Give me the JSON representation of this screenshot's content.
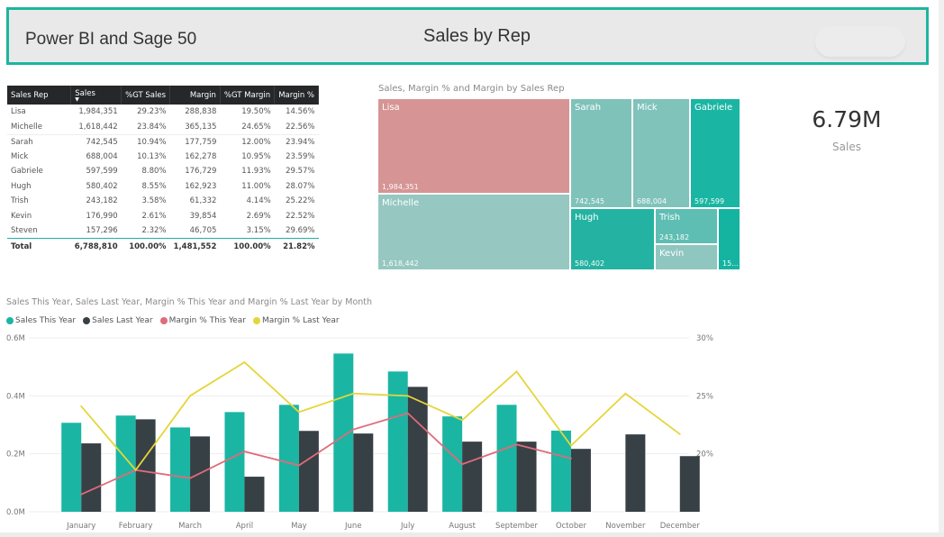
{
  "header": {
    "brand": "Power BI and Sage 50",
    "title": "Sales by Rep",
    "accent": "#1db5a0"
  },
  "table": {
    "columns": [
      "Sales Rep",
      "Sales",
      "%GT Sales",
      "Margin",
      "%GT Margin",
      "Margin %"
    ],
    "sorted_column": "Sales",
    "rows": [
      [
        "Lisa",
        "1,984,351",
        "29.23%",
        "288,838",
        "19.50%",
        "14.56%"
      ],
      [
        "Michelle",
        "1,618,442",
        "23.84%",
        "365,135",
        "24.65%",
        "22.56%"
      ],
      [
        "Sarah",
        "742,545",
        "10.94%",
        "177,759",
        "12.00%",
        "23.94%"
      ],
      [
        "Mick",
        "688,004",
        "10.13%",
        "162,278",
        "10.95%",
        "23.59%"
      ],
      [
        "Gabriele",
        "597,599",
        "8.80%",
        "176,729",
        "11.93%",
        "29.57%"
      ],
      [
        "Hugh",
        "580,402",
        "8.55%",
        "162,923",
        "11.00%",
        "28.07%"
      ],
      [
        "Trish",
        "243,182",
        "3.58%",
        "61,332",
        "4.14%",
        "25.22%"
      ],
      [
        "Kevin",
        "176,990",
        "2.61%",
        "39,854",
        "2.69%",
        "22.52%"
      ],
      [
        "Steven",
        "157,296",
        "2.32%",
        "46,705",
        "3.15%",
        "29.69%"
      ]
    ],
    "total": [
      "Total",
      "6,788,810",
      "100.00%",
      "1,481,552",
      "100.00%",
      "21.82%"
    ]
  },
  "treemap": {
    "title": "Sales, Margin % and Margin by Sales Rep",
    "tiles": [
      {
        "name": "Lisa",
        "value": "1,984,351",
        "color": "#d69594"
      },
      {
        "name": "Michelle",
        "value": "1,618,442",
        "color": "#96c8c1"
      },
      {
        "name": "Sarah",
        "value": "742,545",
        "color": "#7fc2ba"
      },
      {
        "name": "Mick",
        "value": "688,004",
        "color": "#80c3bb"
      },
      {
        "name": "Gabriele",
        "value": "597,599",
        "color": "#1ab6a3"
      },
      {
        "name": "Hugh",
        "value": "580,402",
        "color": "#24b3a2"
      },
      {
        "name": "Trish",
        "value": "243,182",
        "color": "#5fbeb3"
      },
      {
        "name": "Kevin",
        "value": "",
        "color": "#8fc6bf"
      },
      {
        "name": "",
        "value": "15...",
        "color": "#14b4a1"
      }
    ]
  },
  "card": {
    "value": "6.79M",
    "label": "Sales"
  },
  "chart_data": {
    "type": "bar",
    "title": "Sales This Year, Sales Last Year, Margin % This Year and Margin % Last Year by Month",
    "categories": [
      "January",
      "February",
      "March",
      "April",
      "May",
      "June",
      "July",
      "August",
      "September",
      "October",
      "November",
      "December"
    ],
    "legend_position": "top-left",
    "y_left": {
      "ticks": [
        "0.0M",
        "0.2M",
        "0.4M",
        "0.6M"
      ],
      "range": [
        0,
        0.6
      ],
      "unit": "M"
    },
    "y_right": {
      "ticks": [
        "20%",
        "25%",
        "30%"
      ],
      "range": [
        15,
        30
      ],
      "unit": "%"
    },
    "grid": true,
    "series": [
      {
        "name": "Sales This Year",
        "kind": "bar",
        "axis": "left",
        "color": "#1ab6a3",
        "values": [
          0.307,
          0.332,
          0.291,
          0.344,
          0.369,
          0.546,
          0.484,
          0.329,
          0.369,
          0.28,
          null,
          null
        ]
      },
      {
        "name": "Sales Last Year",
        "kind": "bar",
        "axis": "left",
        "color": "#374045",
        "values": [
          0.236,
          0.319,
          0.26,
          0.121,
          0.279,
          0.27,
          0.431,
          0.242,
          0.242,
          0.217,
          0.267,
          0.192
        ]
      },
      {
        "name": "Margin % This Year",
        "kind": "line",
        "axis": "right",
        "color": "#e06b7a",
        "values": [
          16.5,
          18.6,
          17.9,
          20.2,
          19.0,
          22.1,
          23.5,
          19.1,
          20.8,
          19.6,
          null,
          null
        ]
      },
      {
        "name": "Margin % Last Year",
        "kind": "line",
        "axis": "right",
        "color": "#e5d53a",
        "values": [
          24.1,
          18.6,
          25.0,
          27.9,
          23.6,
          25.2,
          25.0,
          22.9,
          27.1,
          20.7,
          25.2,
          21.7
        ]
      }
    ]
  }
}
